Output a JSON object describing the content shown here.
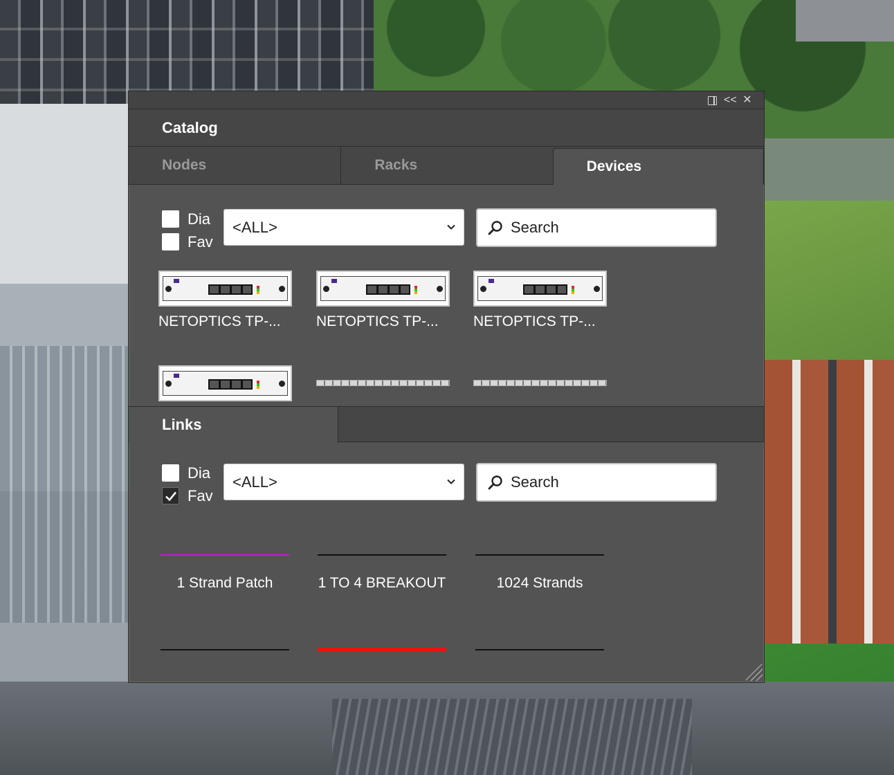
{
  "window": {
    "title": "Catalog",
    "controls": [
      "dock-icon",
      "collapse-icon",
      "close-icon"
    ],
    "collapse_glyph": "<<",
    "close_glyph": "✕"
  },
  "catalog": {
    "tabs": [
      {
        "label": "Nodes",
        "active": false
      },
      {
        "label": "Racks",
        "active": false
      },
      {
        "label": "Devices",
        "active": true
      }
    ],
    "filters": {
      "dia_label": "Dia",
      "dia_checked": false,
      "fav_label": "Fav",
      "fav_checked": false,
      "select_value": "<ALL>",
      "search_placeholder": "Search"
    },
    "devices": [
      {
        "name": "NETOPTICS TP-...",
        "kind": "tap-device"
      },
      {
        "name": "NETOPTICS TP-...",
        "kind": "tap-device"
      },
      {
        "name": "NETOPTICS TP-...",
        "kind": "tap-device"
      },
      {
        "name": "",
        "kind": "tap-device"
      },
      {
        "name": "",
        "kind": "patch-strip"
      },
      {
        "name": "",
        "kind": "patch-strip"
      }
    ]
  },
  "links": {
    "title": "Links",
    "filters": {
      "dia_label": "Dia",
      "dia_checked": false,
      "fav_label": "Fav",
      "fav_checked": true,
      "select_value": "<ALL>",
      "search_placeholder": "Search"
    },
    "items": [
      {
        "name": "1 Strand Patch",
        "color": "#c21bd6"
      },
      {
        "name": "1 TO 4 BREAKOUT",
        "color": "#111111"
      },
      {
        "name": "1024 Strands",
        "color": "#111111"
      },
      {
        "name": "",
        "color": "#111111"
      },
      {
        "name": "",
        "color": "#ee1111"
      },
      {
        "name": "",
        "color": "#111111"
      }
    ]
  }
}
